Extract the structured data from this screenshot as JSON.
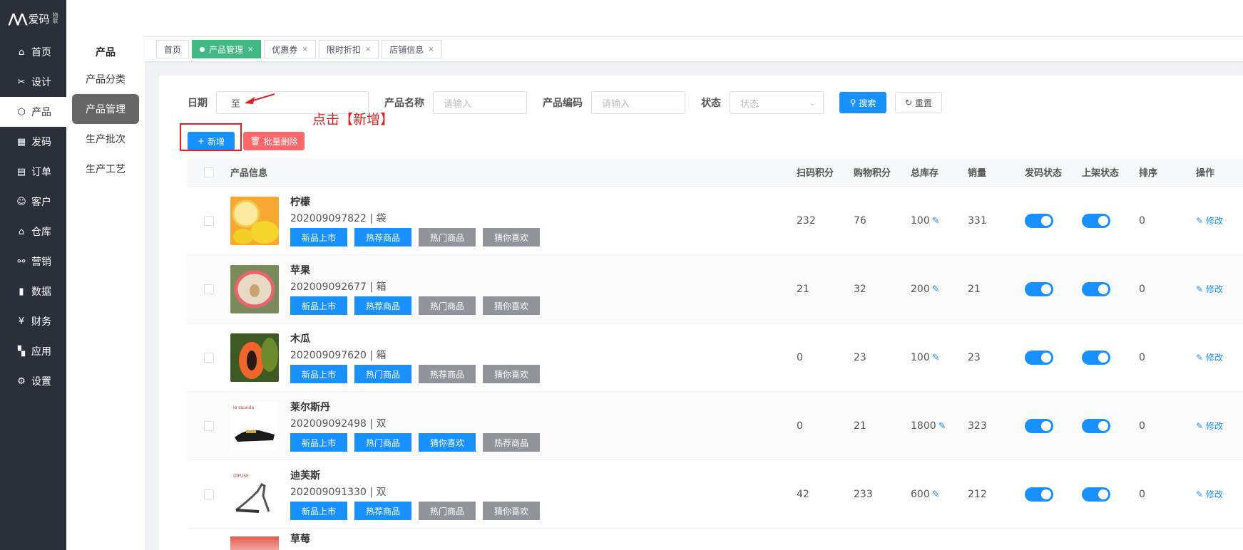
{
  "logo": {
    "text": "爱码",
    "small": "物联"
  },
  "nav": [
    {
      "label": "首页",
      "icon": "home-icon",
      "glyph": "⌂"
    },
    {
      "label": "设计",
      "icon": "tools-icon",
      "glyph": "✂"
    },
    {
      "label": "产品",
      "icon": "box-icon",
      "glyph": "⬡"
    },
    {
      "label": "发码",
      "icon": "qrcode-icon",
      "glyph": "▦"
    },
    {
      "label": "订单",
      "icon": "order-icon",
      "glyph": "▤"
    },
    {
      "label": "客户",
      "icon": "users-icon",
      "glyph": "☺"
    },
    {
      "label": "仓库",
      "icon": "warehouse-icon",
      "glyph": "⌂"
    },
    {
      "label": "营销",
      "icon": "share-icon",
      "glyph": "⚯"
    },
    {
      "label": "数据",
      "icon": "bar-chart-icon",
      "glyph": "▮"
    },
    {
      "label": "财务",
      "icon": "yen-icon",
      "glyph": "¥"
    },
    {
      "label": "应用",
      "icon": "grid-icon",
      "glyph": "▚"
    },
    {
      "label": "设置",
      "icon": "gear-icon",
      "glyph": "⚙"
    }
  ],
  "submenu": {
    "title": "产品",
    "items": [
      "产品分类",
      "产品管理",
      "生产批次",
      "生产工艺"
    ]
  },
  "tabs": [
    "首页",
    "产品管理",
    "优惠券",
    "限时折扣",
    "店铺信息"
  ],
  "filters": {
    "date_label": "日期",
    "date_sep": "至",
    "name_label": "产品名称",
    "name_placeholder": "请输入",
    "code_label": "产品编码",
    "code_placeholder": "请输入",
    "status_label": "状态",
    "status_placeholder": "状态",
    "search": "搜索",
    "reset": "重置"
  },
  "actions": {
    "add": "新增",
    "batch_delete": "批量删除"
  },
  "annotation": "点击【新增】",
  "table": {
    "headers": {
      "info": "产品信息",
      "scan_points": "扫码积分",
      "shop_points": "购物积分",
      "stock": "总库存",
      "sales": "销量",
      "code_status": "发码状态",
      "shelf_status": "上架状态",
      "sort": "排序",
      "ops": "操作"
    },
    "op_label": "修改",
    "rows": [
      {
        "name": "柠檬",
        "code": "202009097822 | 袋",
        "tags": [
          [
            "新品上市",
            "blue"
          ],
          [
            "热荐商品",
            "blue"
          ],
          [
            "热门商品",
            "gray"
          ],
          [
            "猜你喜欢",
            "gray"
          ]
        ],
        "scan": "232",
        "shop": "76",
        "stock": "100",
        "sales": "331",
        "sort": "0",
        "img": "lemon"
      },
      {
        "name": "苹果",
        "code": "202009092677 | 箱",
        "tags": [
          [
            "新品上市",
            "blue"
          ],
          [
            "热荐商品",
            "blue"
          ],
          [
            "热门商品",
            "gray"
          ],
          [
            "猜你喜欢",
            "gray"
          ]
        ],
        "scan": "21",
        "shop": "32",
        "stock": "200",
        "sales": "21",
        "sort": "0",
        "img": "apple"
      },
      {
        "name": "木瓜",
        "code": "202009097620 | 箱",
        "tags": [
          [
            "新品上市",
            "blue"
          ],
          [
            "热门商品",
            "blue"
          ],
          [
            "热荐商品",
            "gray"
          ],
          [
            "猜你喜欢",
            "gray"
          ]
        ],
        "scan": "0",
        "shop": "23",
        "stock": "100",
        "sales": "23",
        "sort": "0",
        "img": "papaya"
      },
      {
        "name": "莱尔斯丹",
        "code": "202009092498 | 双",
        "tags": [
          [
            "新品上市",
            "blue"
          ],
          [
            "热门商品",
            "blue"
          ],
          [
            "猜你喜欢",
            "blue"
          ],
          [
            "热荐商品",
            "gray"
          ]
        ],
        "scan": "0",
        "shop": "21",
        "stock": "1800",
        "sales": "323",
        "sort": "0",
        "img": "shoe1"
      },
      {
        "name": "迪芙斯",
        "code": "202009091330 | 双",
        "tags": [
          [
            "新品上市",
            "blue"
          ],
          [
            "热荐商品",
            "blue"
          ],
          [
            "热门商品",
            "gray"
          ],
          [
            "猜你喜欢",
            "gray"
          ]
        ],
        "scan": "42",
        "shop": "233",
        "stock": "600",
        "sales": "212",
        "sort": "0",
        "img": "shoe2"
      }
    ],
    "partial_row_name": "草莓"
  },
  "colors": {
    "primary": "#1890ff",
    "tab_active": "#42b983",
    "danger": "#ff4d4f",
    "annotation": "#e02020",
    "sidebar": "#2b2f3a"
  }
}
